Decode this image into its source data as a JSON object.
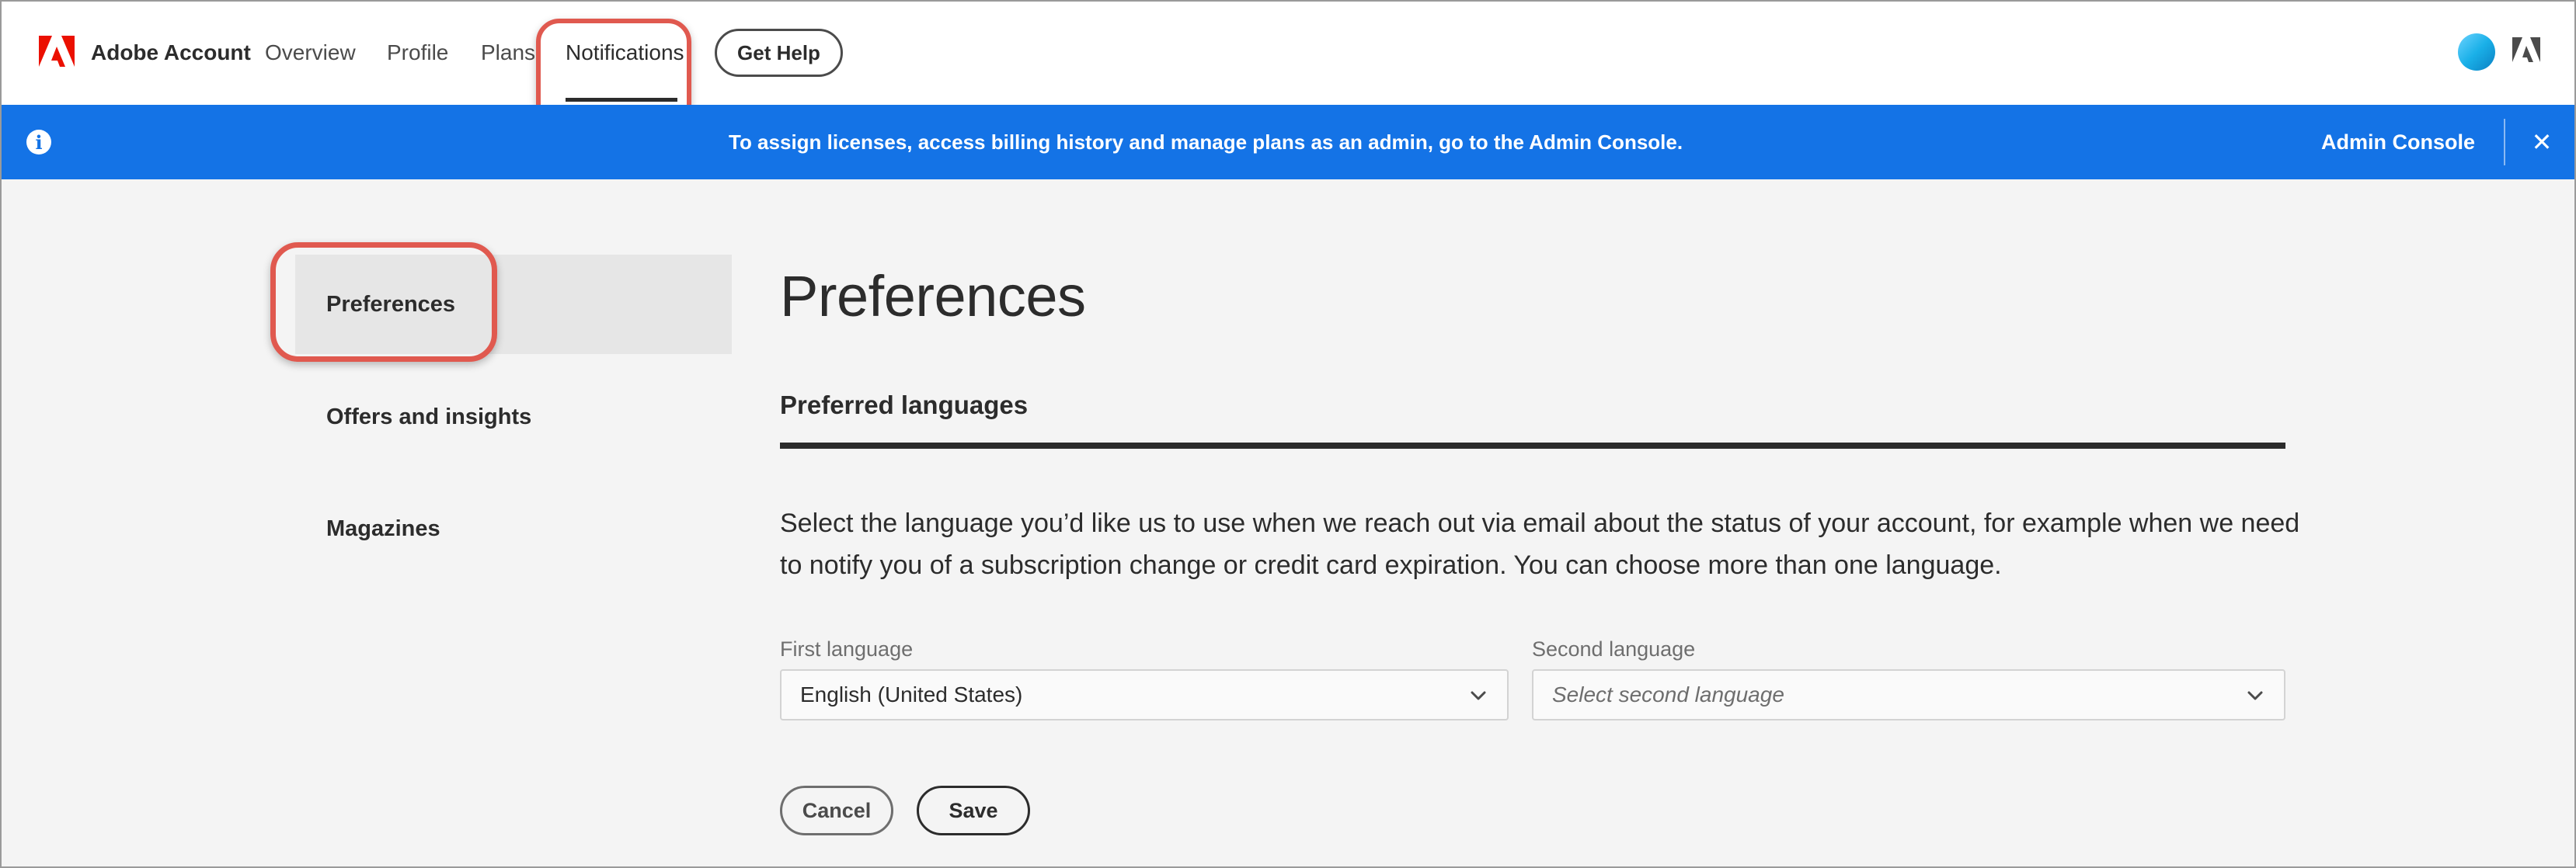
{
  "nav": {
    "brand": "Adobe Account",
    "links": [
      "Overview",
      "Profile",
      "Plans",
      "Notifications"
    ],
    "active": "Notifications",
    "help_label": "Get Help"
  },
  "banner": {
    "text": "To assign licenses, access billing history and manage plans as an admin, go to the Admin Console.",
    "link_label": "Admin Console",
    "close_glyph": "✕",
    "info_glyph": "i"
  },
  "sidebar": {
    "items": [
      {
        "label": "Preferences",
        "active": true
      },
      {
        "label": "Offers and insights",
        "active": false
      },
      {
        "label": "Magazines",
        "active": false
      }
    ]
  },
  "main": {
    "title": "Preferences",
    "section_title": "Preferred languages",
    "description": "Select the language you’d like us to use when we reach out via email about the status of your account, for example when we need to notify you of a subscription change or credit card expiration. You can choose more than one language.",
    "first_language": {
      "label": "First language",
      "value": "English (United States)"
    },
    "second_language": {
      "label": "Second language",
      "placeholder": "Select second language"
    },
    "cancel_label": "Cancel",
    "save_label": "Save"
  },
  "colors": {
    "banner": "#1473e6",
    "highlight": "#e0594f",
    "adobe_red": "#eb1000"
  }
}
